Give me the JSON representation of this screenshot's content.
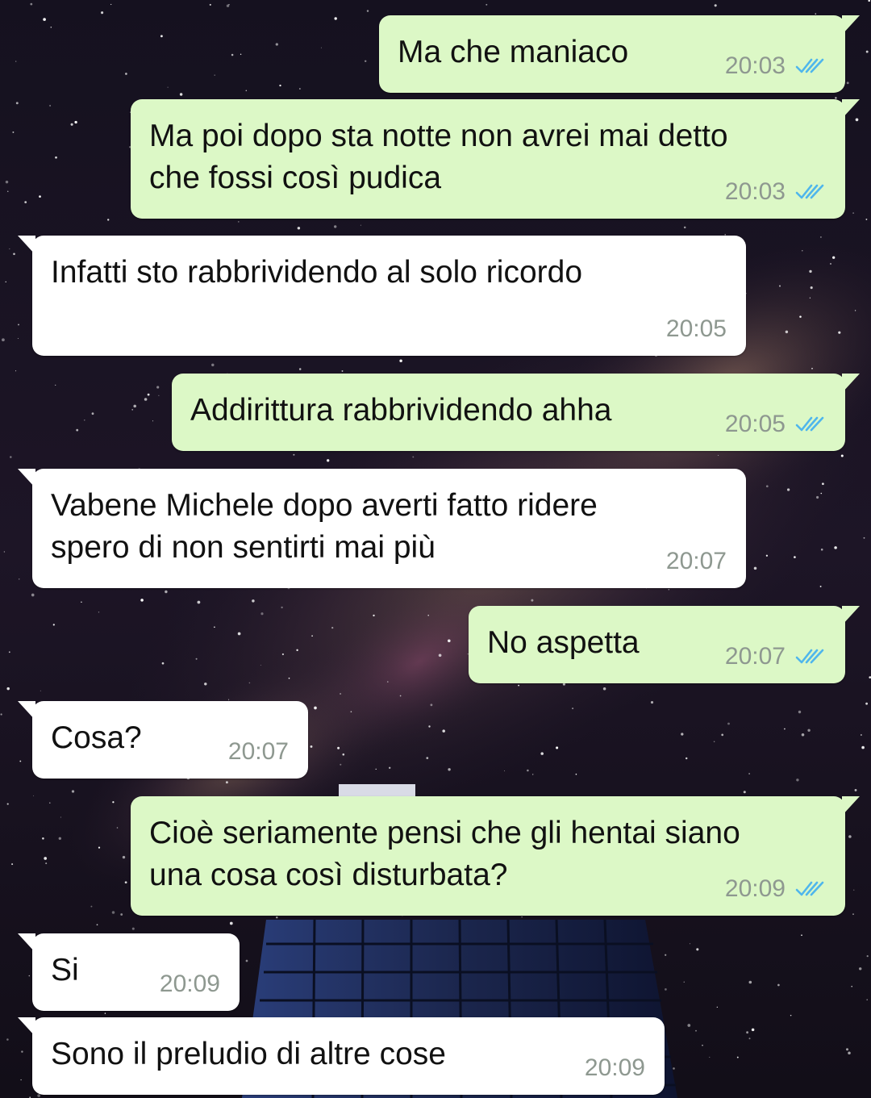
{
  "colors": {
    "outgoing_bubble": "#dcf8c6",
    "incoming_bubble": "#ffffff",
    "timestamp": "#8e9890",
    "read_receipt": "#4fb6ec"
  },
  "background": "starry-night-milky-way-with-building-silhouette",
  "icons": {
    "read_receipt": "double-check-icon"
  },
  "messages": [
    {
      "direction": "outgoing",
      "text": "Ma che maniaco",
      "time": "20:03",
      "status": "read"
    },
    {
      "direction": "outgoing",
      "text": "Ma poi dopo sta notte non avrei mai detto\nche fossi così pudica",
      "time": "20:03",
      "status": "read"
    },
    {
      "direction": "incoming",
      "text": "Infatti sto rabbrividendo al solo ricordo",
      "time": "20:05"
    },
    {
      "direction": "outgoing",
      "text": "Addirittura rabbrividendo ahha",
      "time": "20:05",
      "status": "read"
    },
    {
      "direction": "incoming",
      "text": "Vabene Michele dopo averti fatto ridere\nspero di non sentirti mai più",
      "time": "20:07"
    },
    {
      "direction": "outgoing",
      "text": "No aspetta",
      "time": "20:07",
      "status": "read"
    },
    {
      "direction": "incoming",
      "text": "Cosa?",
      "time": "20:07"
    },
    {
      "direction": "outgoing",
      "text": "Cioè seriamente pensi che gli hentai siano\nuna cosa così disturbata?",
      "time": "20:09",
      "status": "read"
    },
    {
      "direction": "incoming",
      "text": "Si",
      "time": "20:09"
    },
    {
      "direction": "incoming",
      "text": "Sono il preludio di altre cose",
      "time": "20:09"
    }
  ]
}
